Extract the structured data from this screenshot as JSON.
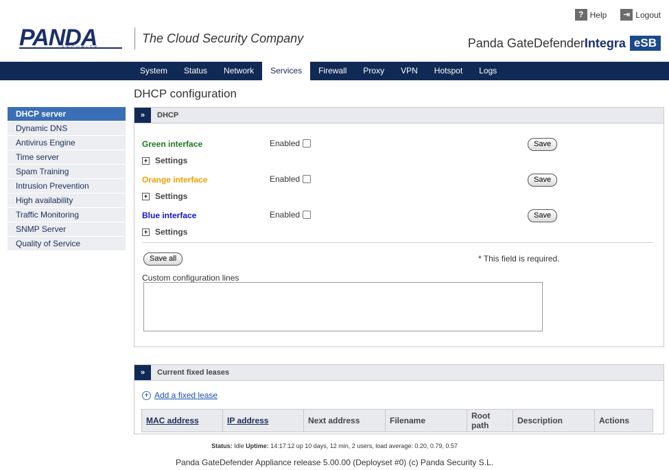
{
  "header": {
    "help_label": "Help",
    "logout_label": "Logout",
    "logo_text": "PANDA",
    "logo_subtext": "SECURITY",
    "tagline": "The Cloud Security Company",
    "product_prefix": "Panda ",
    "product_main": "GateDefender",
    "product_bold": "Integra",
    "product_badge": "eSB"
  },
  "nav": {
    "items": [
      "System",
      "Status",
      "Network",
      "Services",
      "Firewall",
      "Proxy",
      "VPN",
      "Hotspot",
      "Logs"
    ],
    "active": "Services"
  },
  "sidebar": {
    "items": [
      "DHCP server",
      "Dynamic DNS",
      "Antivirus Engine",
      "Time server",
      "Spam Training",
      "Intrusion Prevention",
      "High availability",
      "Traffic Monitoring",
      "SNMP Server",
      "Quality of Service"
    ],
    "active": "DHCP server"
  },
  "page": {
    "title": "DHCP configuration"
  },
  "dhcp_panel": {
    "title": "DHCP",
    "interfaces": [
      {
        "name": "Green interface",
        "color": "#1a7a1a",
        "enabled_label": "Enabled",
        "save_label": "Save",
        "settings_label": "Settings"
      },
      {
        "name": "Orange interface",
        "color": "#f0a000",
        "enabled_label": "Enabled",
        "save_label": "Save",
        "settings_label": "Settings"
      },
      {
        "name": "Blue interface",
        "color": "#1414c8",
        "enabled_label": "Enabled",
        "save_label": "Save",
        "settings_label": "Settings"
      }
    ],
    "save_all_label": "Save all",
    "required_note": "* This field is required.",
    "custom_lines_label": "Custom configuration lines",
    "custom_lines_value": ""
  },
  "leases_panel": {
    "title": "Current fixed leases",
    "add_label": "Add a fixed lease",
    "columns": [
      "MAC address",
      "IP address",
      "Next address",
      "Filename",
      "Root path",
      "Description",
      "Actions"
    ]
  },
  "status_bar": {
    "status_label": "Status:",
    "status_value": "Idle",
    "uptime_label": "Uptime:",
    "uptime_value": "14:17:12 up 10 days, 12 min, 2 users, load average: 0.20, 0.79, 0.57"
  },
  "footer": {
    "text": "Panda GateDefender Appliance release 5.00.00 (Deployset #0) (c) Panda Security S.L."
  }
}
